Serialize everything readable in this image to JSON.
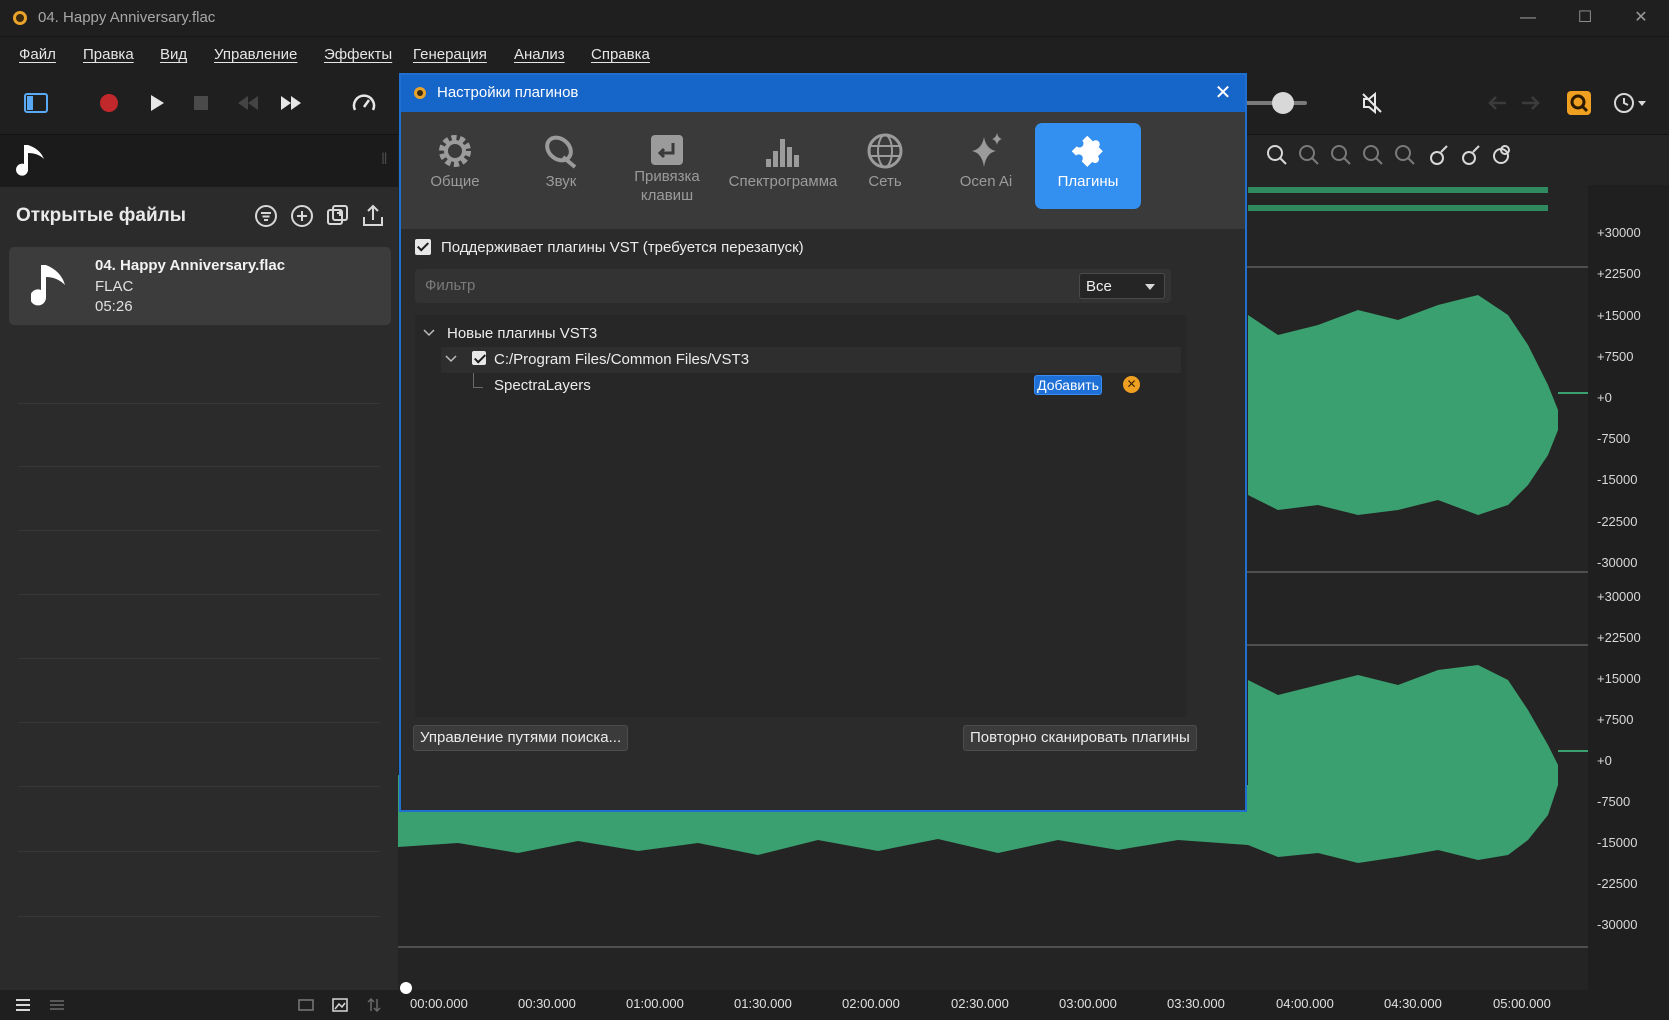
{
  "window": {
    "title": "04. Happy Anniversary.flac",
    "minimize": "—",
    "maximize": "☐",
    "close": "✕"
  },
  "menu": [
    "Файл",
    "Правка",
    "Вид",
    "Управление",
    "Эффекты",
    "Генерация",
    "Анализ",
    "Справка"
  ],
  "left_panel": {
    "header": "Открытые файлы",
    "file": {
      "name": "04. Happy Anniversary.flac",
      "format": "FLAC",
      "duration": "05:26"
    }
  },
  "dialog": {
    "title": "Настройки плагинов",
    "close": "✕",
    "tabs": [
      {
        "label": "Общие",
        "icon": "gear-icon"
      },
      {
        "label": "Звук",
        "icon": "speaker-icon"
      },
      {
        "label": "Привязка клавиш",
        "icon": "keyboard-enter-icon"
      },
      {
        "label": "Спектрограмма",
        "icon": "spectrogram-icon"
      },
      {
        "label": "Сеть",
        "icon": "globe-icon"
      },
      {
        "label": "Ocen Ai",
        "icon": "sparkle-icon"
      },
      {
        "label": "Плагины",
        "icon": "puzzle-icon",
        "active": true
      }
    ],
    "vst_support_label": "Поддерживает плагины VST (требуется перезапуск)",
    "filter_placeholder": "Фильтр",
    "filter_select": "Все",
    "tree": {
      "group": "Новые плагины VST3",
      "path": "C:/Program Files/Common Files/VST3",
      "plugin": "SpectraLayers",
      "add_button": "Добавить"
    },
    "manage_paths_button": "Управление путями поиска...",
    "rescan_button": "Повторно сканировать плагины"
  },
  "ruler_top": [
    "+30000",
    "+22500",
    "+15000",
    "+7500",
    "+0",
    "-7500",
    "-15000",
    "-22500",
    "-30000"
  ],
  "ruler_bottom": [
    "+30000",
    "+22500",
    "+15000",
    "+7500",
    "+0",
    "-7500",
    "-15000",
    "-22500",
    "-30000"
  ],
  "timeline": [
    "00:00.000",
    "00:30.000",
    "01:00.000",
    "01:30.000",
    "02:00.000",
    "02:30.000",
    "03:00.000",
    "03:30.000",
    "04:00.000",
    "04:30.000",
    "05:00.000"
  ],
  "colors": {
    "accent": "#1665c9",
    "active_tab": "#3390f0",
    "waveform": "#3aa06f",
    "record": "#c0282b",
    "warning": "#f0a020"
  }
}
